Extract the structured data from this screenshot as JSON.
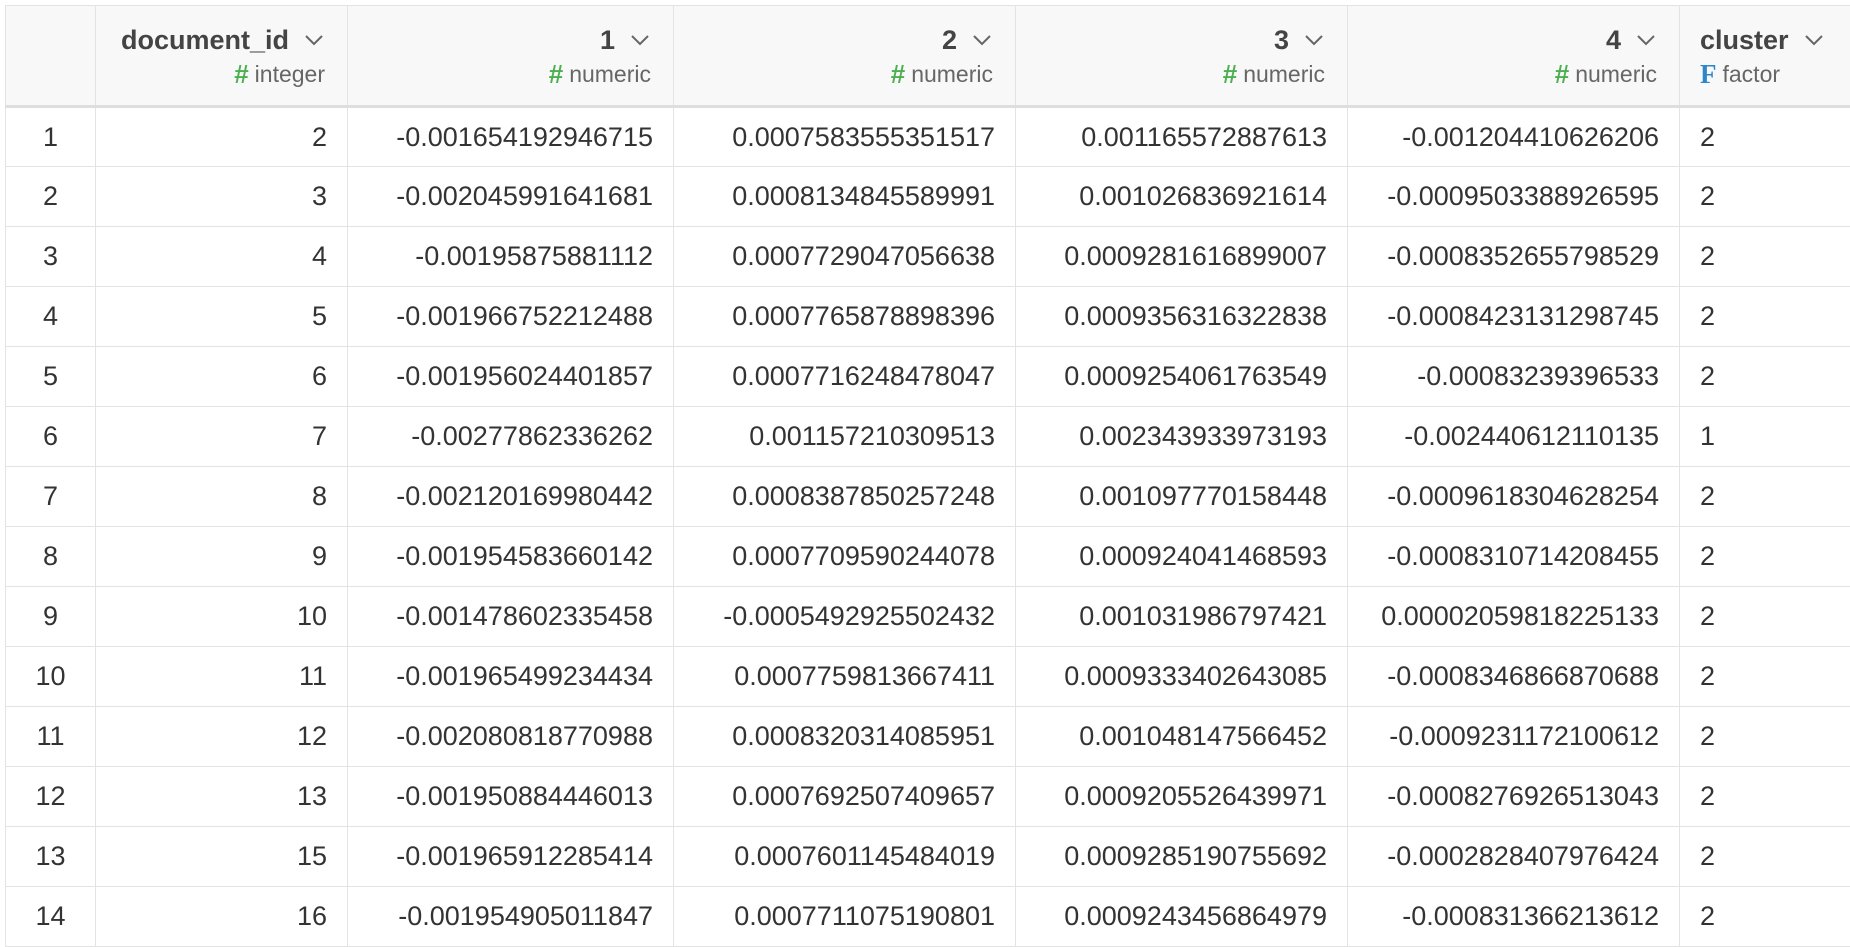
{
  "columns": [
    {
      "name": "document_id",
      "type": "integer",
      "icon": "numeric-hash-icon"
    },
    {
      "name": "1",
      "type": "numeric",
      "icon": "numeric-hash-icon"
    },
    {
      "name": "2",
      "type": "numeric",
      "icon": "numeric-hash-icon"
    },
    {
      "name": "3",
      "type": "numeric",
      "icon": "numeric-hash-icon"
    },
    {
      "name": "4",
      "type": "numeric",
      "icon": "numeric-hash-icon"
    },
    {
      "name": "cluster",
      "type": "factor",
      "icon": "factor-f-icon"
    }
  ],
  "type_glyphs": {
    "numeric": "#",
    "factor": "F"
  },
  "colors": {
    "numeric_icon": "#4caf50",
    "factor_icon": "#2e86c9",
    "grid_line": "#e3e3e3",
    "header_bg": "#f8f8f8"
  },
  "rows": [
    {
      "n": "1",
      "cells": [
        "2",
        "-0.001654192946715",
        "0.0007583555351517",
        "0.001165572887613",
        "-0.001204410626206",
        "2"
      ]
    },
    {
      "n": "2",
      "cells": [
        "3",
        "-0.002045991641681",
        "0.0008134845589991",
        "0.001026836921614",
        "-0.0009503388926595",
        "2"
      ]
    },
    {
      "n": "3",
      "cells": [
        "4",
        "-0.00195875881112",
        "0.0007729047056638",
        "0.0009281616899007",
        "-0.0008352655798529",
        "2"
      ]
    },
    {
      "n": "4",
      "cells": [
        "5",
        "-0.001966752212488",
        "0.0007765878898396",
        "0.0009356316322838",
        "-0.0008423131298745",
        "2"
      ]
    },
    {
      "n": "5",
      "cells": [
        "6",
        "-0.001956024401857",
        "0.0007716248478047",
        "0.0009254061763549",
        "-0.00083239396533",
        "2"
      ]
    },
    {
      "n": "6",
      "cells": [
        "7",
        "-0.00277862336262",
        "0.001157210309513",
        "0.002343933973193",
        "-0.002440612110135",
        "1"
      ]
    },
    {
      "n": "7",
      "cells": [
        "8",
        "-0.002120169980442",
        "0.0008387850257248",
        "0.001097770158448",
        "-0.0009618304628254",
        "2"
      ]
    },
    {
      "n": "8",
      "cells": [
        "9",
        "-0.001954583660142",
        "0.0007709590244078",
        "0.000924041468593",
        "-0.0008310714208455",
        "2"
      ]
    },
    {
      "n": "9",
      "cells": [
        "10",
        "-0.001478602335458",
        "-0.0005492925502432",
        "0.001031986797421",
        "0.00002059818225133",
        "2"
      ]
    },
    {
      "n": "10",
      "cells": [
        "11",
        "-0.001965499234434",
        "0.0007759813667411",
        "0.0009333402643085",
        "-0.0008346866870688",
        "2"
      ]
    },
    {
      "n": "11",
      "cells": [
        "12",
        "-0.002080818770988",
        "0.0008320314085951",
        "0.001048147566452",
        "-0.0009231172100612",
        "2"
      ]
    },
    {
      "n": "12",
      "cells": [
        "13",
        "-0.001950884446013",
        "0.0007692507409657",
        "0.0009205526439971",
        "-0.0008276926513043",
        "2"
      ]
    },
    {
      "n": "13",
      "cells": [
        "15",
        "-0.001965912285414",
        "0.0007601145484019",
        "0.0009285190755692",
        "-0.0002828407976424",
        "2"
      ]
    },
    {
      "n": "14",
      "cells": [
        "16",
        "-0.001954905011847",
        "0.0007711075190801",
        "0.0009243456864979",
        "-0.000831366213612",
        "2"
      ]
    }
  ]
}
